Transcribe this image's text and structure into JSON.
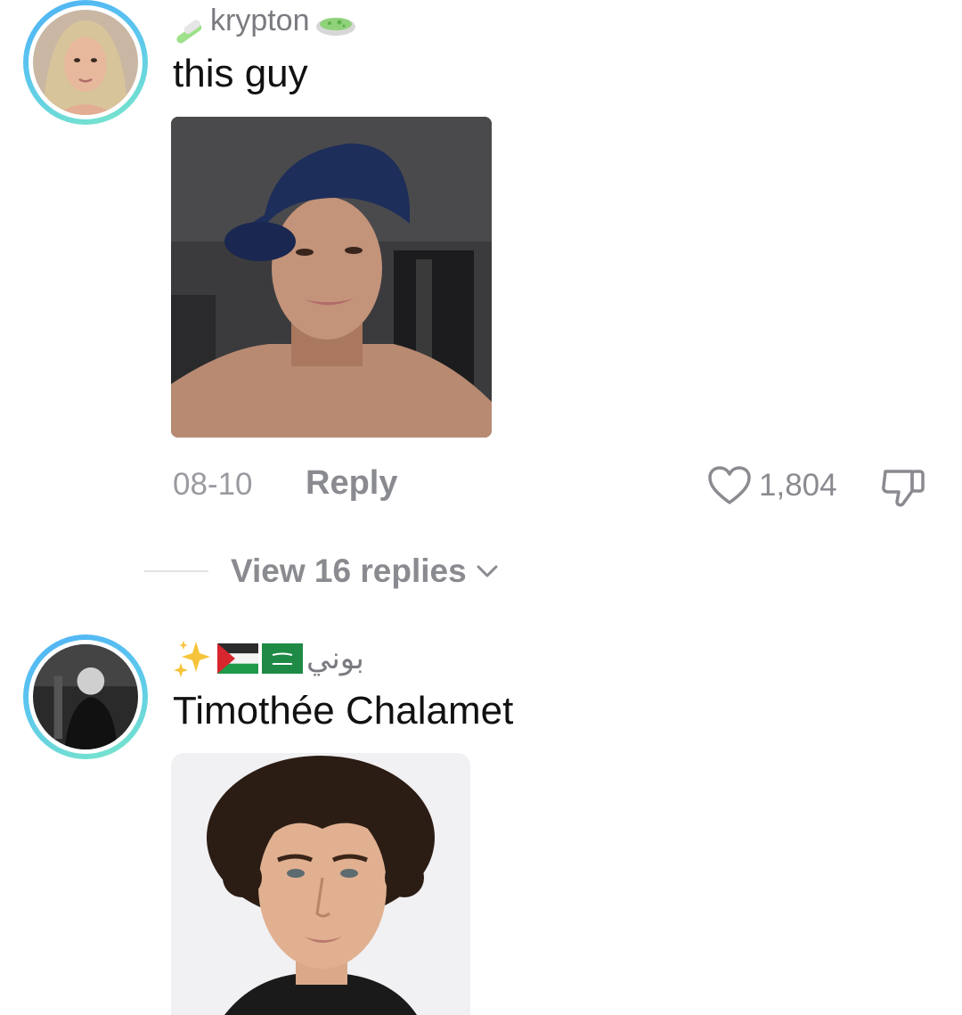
{
  "comments": [
    {
      "username": "krypton",
      "text": "this guy",
      "date": "08-10",
      "reply_label": "Reply",
      "like_count": "1,804",
      "view_replies_label": "View 16 replies"
    },
    {
      "username": "بوني",
      "text": "Timothée Chalamet"
    }
  ],
  "icons": {
    "username_prefix_1": "test-tube-icon",
    "username_suffix_1": "petri-dish-icon",
    "username_prefix_2": "sparkles-icon",
    "flag_a": "palestine-flag-icon",
    "flag_b": "saudi-arabia-flag-icon",
    "like": "heart-outline-icon",
    "dislike": "thumbs-down-outline-icon",
    "chevron": "chevron-down-icon"
  },
  "colors": {
    "avatar_ring_start": "#4fb2f5",
    "avatar_ring_end": "#7ae8c8",
    "muted_text": "#8a8b90",
    "primary_text": "#111111"
  }
}
